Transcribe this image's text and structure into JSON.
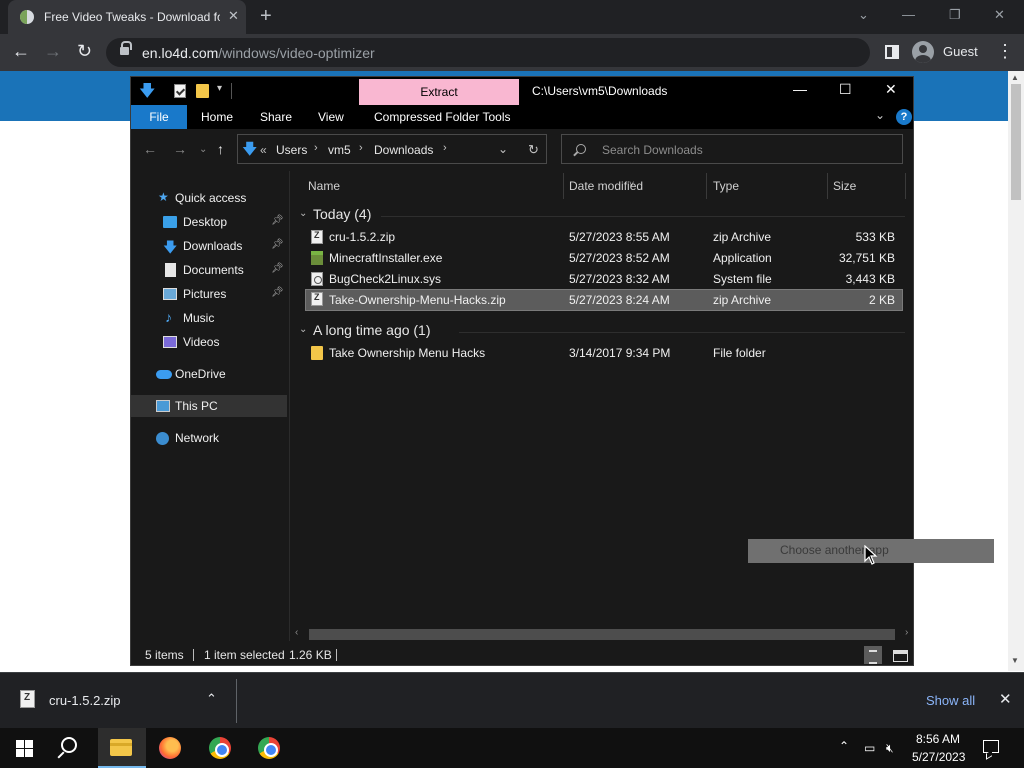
{
  "browser": {
    "tab_title": "Free Video Tweaks - Download for Windows",
    "tab_close": "✕",
    "new_tab": "+",
    "url_host": "en.lo4d.com",
    "url_path": "/windows/video-optimizer",
    "profile_label": "Guest",
    "window_controls": [
      "⌄",
      "—",
      "❐",
      "✕"
    ]
  },
  "explorer": {
    "extract_tab": "Extract",
    "title": "C:\\Users\\vm5\\Downloads",
    "ribbon_tabs": [
      "File",
      "Home",
      "Share",
      "View",
      "Compressed Folder Tools"
    ],
    "help": "?",
    "breadcrumb": [
      "Users",
      "vm5",
      "Downloads"
    ],
    "breadcrumb_prefix": "«",
    "search_placeholder": "Search Downloads",
    "nav": {
      "quick_access": "Quick access",
      "items": [
        "Desktop",
        "Downloads",
        "Documents",
        "Pictures",
        "Music",
        "Videos"
      ],
      "onedrive": "OneDrive",
      "this_pc": "This PC",
      "network": "Network"
    },
    "columns": [
      "Name",
      "Date modified",
      "Type",
      "Size"
    ],
    "groups": [
      {
        "label": "Today (4)",
        "files": [
          {
            "name": "cru-1.5.2.zip",
            "date": "5/27/2023 8:55 AM",
            "type": "zip Archive",
            "size": "533 KB",
            "icon": "zip-icon"
          },
          {
            "name": "MinecraftInstaller.exe",
            "date": "5/27/2023 8:52 AM",
            "type": "Application",
            "size": "32,751 KB",
            "icon": "minecraft-icon"
          },
          {
            "name": "BugCheck2Linux.sys",
            "date": "5/27/2023 8:32 AM",
            "type": "System file",
            "size": "3,443 KB",
            "icon": "system-file-icon"
          },
          {
            "name": "Take-Ownership-Menu-Hacks.zip",
            "date": "5/27/2023 8:24 AM",
            "type": "zip Archive",
            "size": "2 KB",
            "icon": "zip-icon"
          }
        ]
      },
      {
        "label": "A long time ago (1)",
        "files": [
          {
            "name": "Take Ownership Menu Hacks",
            "date": "3/14/2017 9:34 PM",
            "type": "File folder",
            "size": "",
            "icon": "folder-icon"
          }
        ]
      }
    ],
    "tooltip": "Choose another app",
    "status": {
      "items": "5 items",
      "selected": "1 item selected",
      "size": "1.26 KB"
    }
  },
  "downloads_shelf": {
    "file": "cru-1.5.2.zip",
    "show_all": "Show all",
    "close": "✕"
  },
  "taskbar": {
    "time": "8:56 AM",
    "date": "5/27/2023"
  }
}
